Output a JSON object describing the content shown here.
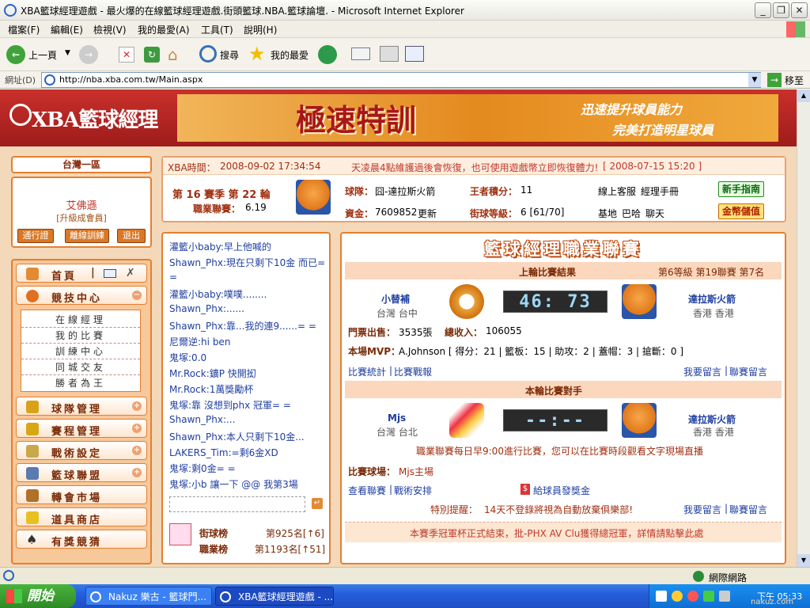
{
  "window": {
    "title": "XBA籃球經理遊戲 - 最火爆的在線籃球經理遊戲.街頭籃球.NBA.籃球論壇. - Microsoft Internet Explorer"
  },
  "menu": [
    "檔案(F)",
    "編輯(E)",
    "檢視(V)",
    "我的最愛(A)",
    "工具(T)",
    "說明(H)"
  ],
  "toolbar": {
    "back": "上一頁",
    "search": "搜尋",
    "favorites": "我的最愛"
  },
  "address": {
    "label": "網址(D)",
    "url": "http://nba.xba.com.tw/Main.aspx",
    "go": "移至"
  },
  "site": {
    "logo": "XBA籃球經理",
    "banner_main": "極速特訓",
    "banner_sub1": "迅速提升球員能力",
    "banner_sub2": "完美打造明星球員"
  },
  "left": {
    "server": "台灣一區",
    "user_name": "艾佛遜",
    "user_level": "[升級成會員]",
    "btn_pass": "通行證",
    "btn_train": "離線訓練",
    "btn_exit": "退出",
    "nav": {
      "home": "首頁",
      "arena": "競技中心",
      "arena_sub": [
        "在線經理",
        "我的比賽",
        "訓練中心",
        "同城交友",
        "勝者為王"
      ],
      "team": "球隊管理",
      "schedule": "賽程管理",
      "tactics": "戰術設定",
      "league": "籃球聯盟",
      "transfer": "轉會市場",
      "shop": "道具商店",
      "quiz": "有獎競猜"
    },
    "home_sep": "|"
  },
  "info": {
    "time_label": "XBA時間：",
    "time": "2008-09-02 17:34:54",
    "notice": "天凌晨4點維護過後會恢復，也可使用遊戲幣立即恢復體力!",
    "notice_date": "[ 2008-07-15 15:20 ]",
    "season": "第 16 賽季 第 22 輪",
    "pro_label": "職業聯賽：",
    "pro_value": "6.19",
    "team_label": "球隊：",
    "team_value": "囧-達拉斯火箭",
    "king_label": "王者積分：",
    "king_value": "11",
    "online": "線上客服",
    "manual": "經理手冊",
    "guide_btn": "新手指南",
    "funds_label": "資金：",
    "funds_value": "7609852",
    "refresh": "更新",
    "street_label": "街球等級：",
    "street_value": "6 [61/70]",
    "base": "基地",
    "bar": "巴哈",
    "chat": "聊天",
    "coin_btn": "金幣儲值"
  },
  "chat": [
    {
      "user": "灌籃小baby",
      "msg": ":早上他喊的"
    },
    {
      "user": "Shawn_Phx",
      "msg": ":現在只剩下10金  而已="
    },
    {
      "user": "",
      "msg": "="
    },
    {
      "user": "灌籃小baby",
      "msg": ":噗噗........"
    },
    {
      "user": "Shawn_Phx",
      "msg": ":......"
    },
    {
      "user": "Shawn_Phx",
      "msg": ":靠...我的連9......= ="
    },
    {
      "user": "尼爾逆",
      "msg": ":hi ben"
    },
    {
      "user": "鬼塚",
      "msg": ":0.0"
    },
    {
      "user": "Mr.Rock",
      "msg": ":鑛P 快開抝"
    },
    {
      "user": "Mr.Rock",
      "msg": ":1萬獎勵杯"
    },
    {
      "user": "鬼塚",
      "msg": ":靠 沒想到phx 冠軍= ="
    },
    {
      "user": "Shawn_Phx",
      "msg": ":..."
    },
    {
      "user": "Shawn_Phx",
      "msg": ":本人只剩下10金..."
    },
    {
      "user": "LAKERS_Tim",
      "msg": ":=剩6金XD"
    },
    {
      "user": "鬼塚",
      "msg": ":剩0金= ="
    },
    {
      "user": "鬼塚",
      "msg": ":小b 讓一下  @@ 我第3場"
    }
  ],
  "rank": {
    "street_label": "街球榜",
    "street_value": "第925名[↑6]",
    "pro_label": "職業榜",
    "pro_value": "第1193名[↑51]"
  },
  "league": {
    "title": "籃球經理職業聯賽",
    "last_title": "上輪比賽結果",
    "last_meta": "第6等級  第19聯賽  第7名",
    "home_team": "小替補",
    "home_city": "台灣  台中",
    "score": "46: 73",
    "away_team": "達拉斯火箭",
    "away_city": "香港  香港",
    "tickets_label": "門票出售：",
    "tickets_value": "3535張",
    "income_label": "總收入：",
    "income_value": "106055",
    "mvp_label": "本場MVP：",
    "mvp_value": "A.Johnson  [ 得分：21 | 籃板：15 | 助攻：2 | 蓋帽：3 | 搶斷：0 ]",
    "stats_link": "比賽統計",
    "report_link": "比賽戰報",
    "msg1": "我要留言",
    "msg2": "聯賽留言",
    "next_title": "本輪比賽對手",
    "next_home": "Mjs",
    "next_home_city": "台灣  台北",
    "next_score": "--:--",
    "next_away": "達拉斯火箭",
    "next_away_city": "香港  香港",
    "daily_notice": "職業聯賽每日早9:00進行比賽，您可以在比賽時段觀看文字現場直播",
    "venue_label": "比賽球場：",
    "venue_value": "Mjs主場",
    "view_league": "查看聯賽",
    "tactics": "戰術安排",
    "bonus": "給球員發獎金",
    "warn_label": "特別提醒：",
    "warn_value": "14天不登錄將視為自動放棄俱樂部!",
    "msg3": "我要留言",
    "msg4": "聯賽留言",
    "footer": "本賽季冠軍杯正式結束，批-PHX AV Clu獲得總冠軍，詳情請點擊此處"
  },
  "status": {
    "zone": "網際網路"
  },
  "taskbar": {
    "start": "開始",
    "task1": "Nakuz 樂古 - 籃球門...",
    "task2": "XBA籃球經理遊戲 - ...",
    "clock": "下午 05:33",
    "watermark": "nakuz.com"
  },
  "colors": {
    "accent": "#e47f31",
    "header": "#b8271f",
    "link": "#1f3ea0"
  }
}
